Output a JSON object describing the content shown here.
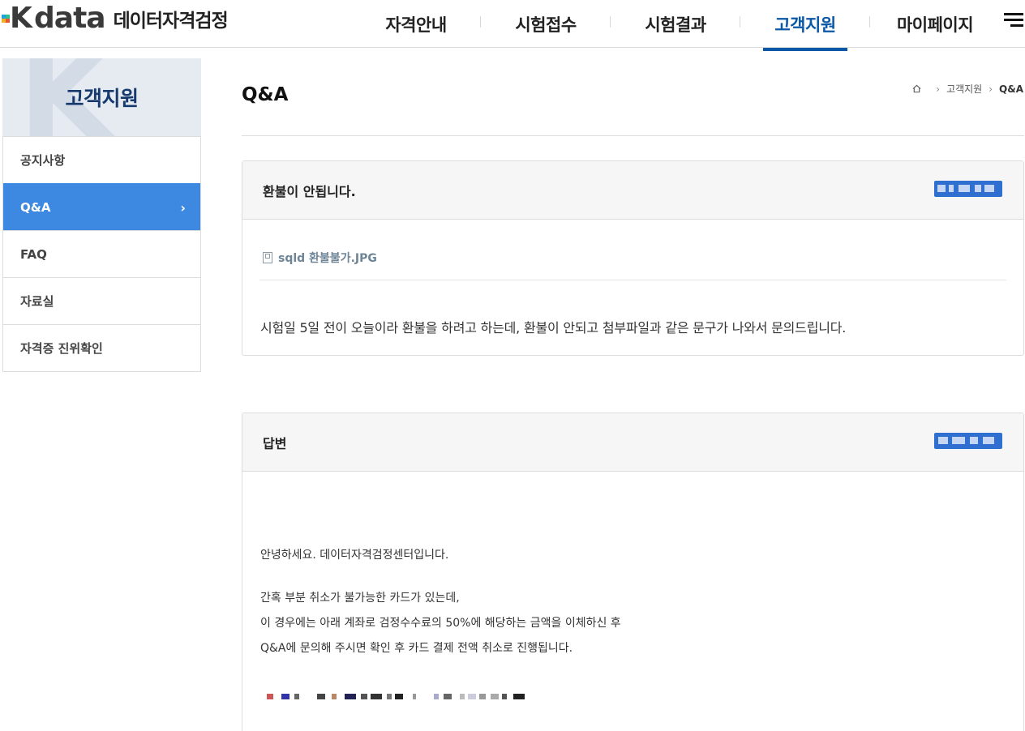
{
  "header": {
    "logo_word": "data",
    "logo_k": "K",
    "logo_kr": "데이터자격검정",
    "nav": [
      "자격안내",
      "시험접수",
      "시험결과",
      "고객지원",
      "마이페이지"
    ],
    "active_nav": "고객지원",
    "menu_icon": "hamburger-icon",
    "accent_color": "#0a58a6"
  },
  "sidebar": {
    "title": "고객지원",
    "items": [
      {
        "label": "공지사항"
      },
      {
        "label": "Q&A",
        "active": true
      },
      {
        "label": "FAQ"
      },
      {
        "label": "자료실"
      },
      {
        "label": "자격증 진위확인"
      }
    ],
    "active_color": "#3d88e0",
    "chevron": "›"
  },
  "main": {
    "page_title": "Q&A",
    "breadcrumb": [
      "고객지원",
      "Q&A"
    ],
    "question": {
      "title": "환불이 안됩니다.",
      "attachment": "sqld 환불불가.JPG",
      "body": "시험일 5일 전이 오늘이라 환불을 하려고 하는데, 환불이 안되고 첨부파일과 같은 문구가 나와서 문의드립니다."
    },
    "answer": {
      "title": "답변",
      "lines": [
        "안녕하세요. 데이터자격검정센터입니다.",
        "간혹 부분 취소가 불가능한 카드가 있는데,",
        "이 경우에는 아래 계좌로 검정수수료의 50%에 해당하는 금액을 이체하신 후",
        "Q&A에 문의해 주시면 확인 후 카드 결제 전액 취소로 진행됩니다."
      ]
    }
  }
}
